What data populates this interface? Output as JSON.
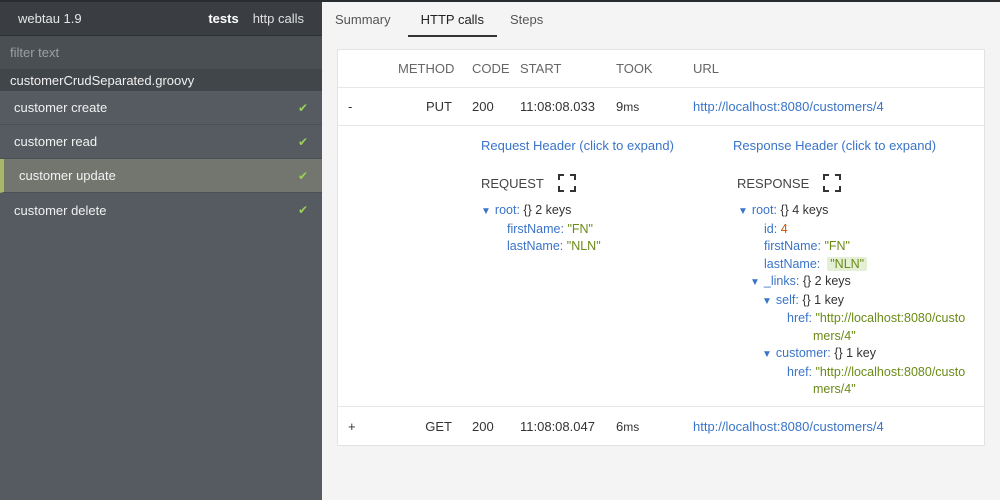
{
  "topbar": {
    "brand": "webtau 1.9",
    "tab_tests": "tests",
    "tab_http": "http calls"
  },
  "filter": {
    "placeholder": "filter text"
  },
  "group": "customerCrudSeparated.groovy",
  "tests": [
    {
      "label": "customer create",
      "check": "✔"
    },
    {
      "label": "customer read",
      "check": "✔"
    },
    {
      "label": "customer update",
      "check": "✔"
    },
    {
      "label": "customer delete",
      "check": "✔"
    }
  ],
  "main_tabs": [
    "Summary",
    "HTTP calls",
    "Steps"
  ],
  "table": {
    "headers": {
      "method": "METHOD",
      "code": "CODE",
      "start": "START",
      "took": "TOOK",
      "url": "URL"
    },
    "rows": [
      {
        "toggle": "-",
        "method": "PUT",
        "code": "200",
        "start": "11:08:08.033",
        "took": "9",
        "unit": "ms",
        "url": "http://localhost:8080/customers/4"
      },
      {
        "toggle": "+",
        "method": "GET",
        "code": "200",
        "start": "11:08:08.047",
        "took": "6",
        "unit": "ms",
        "url": "http://localhost:8080/customers/4"
      }
    ]
  },
  "details": {
    "request_header_link": "Request Header (click to expand)",
    "response_header_link": "Response Header (click to expand)",
    "request_title": "REQUEST",
    "response_title": "RESPONSE",
    "request": {
      "root": "root:",
      "root_meta": "{}  2 keys",
      "k1": "firstName:",
      "v1": "\"FN\"",
      "k2": "lastName:",
      "v2": "\"NLN\""
    },
    "response": {
      "root": "root:",
      "root_meta": "{}  4 keys",
      "id_k": "id:",
      "id_v": "4",
      "fn_k": "firstName:",
      "fn_v": "\"FN\"",
      "ln_k": "lastName:",
      "ln_v": "\"NLN\"",
      "links_k": "_links:",
      "links_meta": "{}  2 keys",
      "self_k": "self:",
      "self_meta": "{}  1 key",
      "href_k": "href:",
      "self_href_1": "\"http://localhost:8080/custo",
      "self_href_2": "mers/4\"",
      "cust_k": "customer:",
      "cust_meta": "{}  1 key",
      "cust_href_1": "\"http://localhost:8080/custo",
      "cust_href_2": "mers/4\""
    }
  },
  "colors": {
    "sidebar": "#555b60",
    "accent_link": "#3a74c7",
    "string_value": "#6b8a17",
    "number_value": "#d35400",
    "check": "#9ccf5a"
  }
}
